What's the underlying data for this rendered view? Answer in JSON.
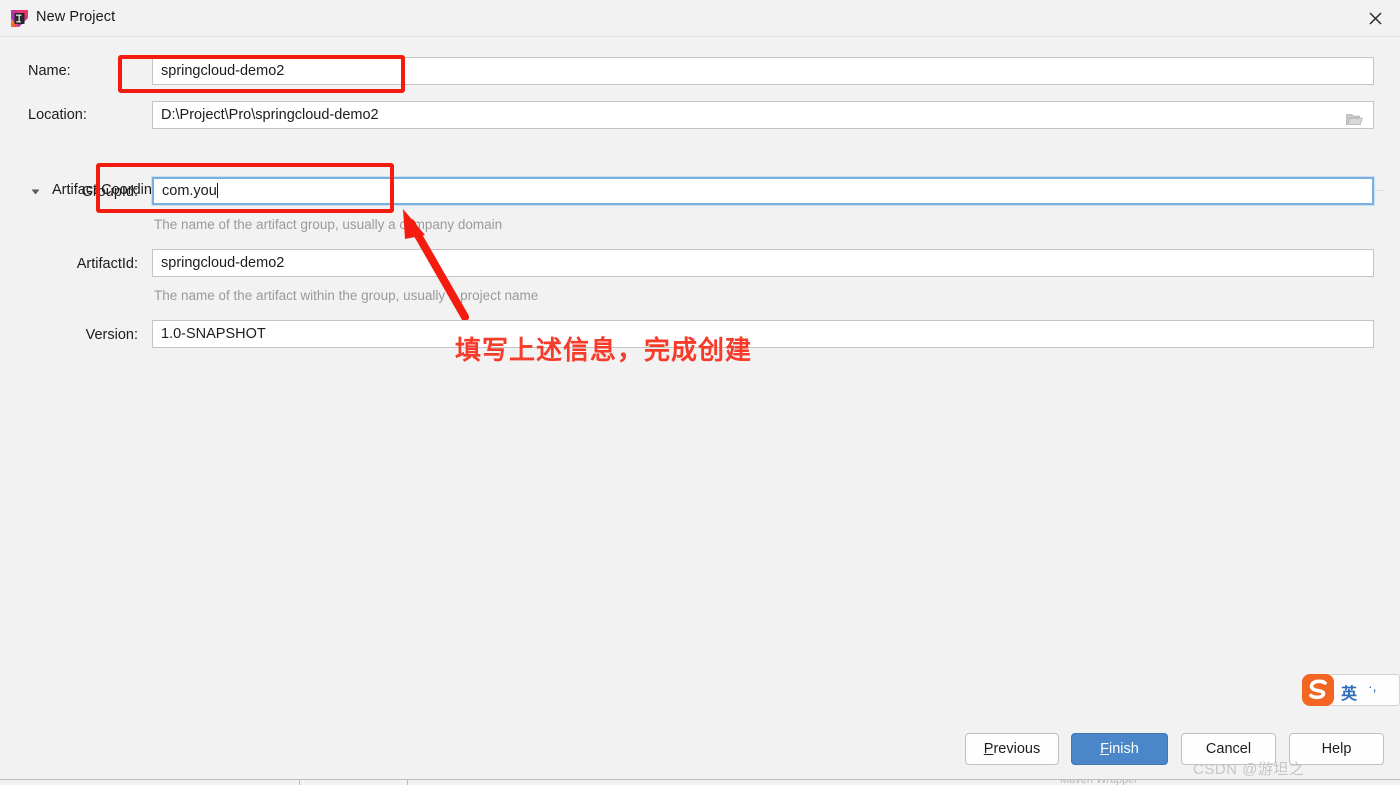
{
  "window": {
    "title": "New Project",
    "app_icon": "intellij-idea-icon",
    "close_icon": "close-icon"
  },
  "form": {
    "fields": [
      {
        "label": "Name:",
        "value": "springcloud-demo2"
      },
      {
        "label": "Location:",
        "value": "D:\\Project\\Pro\\springcloud-demo2",
        "browse_icon": "folder-icon"
      },
      {
        "label": "GroupId:",
        "value": "com.you",
        "focused": true,
        "hint": "The name of the artifact group, usually a company domain"
      },
      {
        "label": "ArtifactId:",
        "value": "springcloud-demo2",
        "hint": "The name of the artifact within the group, usually a project name"
      },
      {
        "label": "Version:",
        "value": "1.0-SNAPSHOT"
      }
    ],
    "section": {
      "title": "Artifact Coordinates",
      "expanded": true,
      "toggle_icon": "triangle-down-icon"
    }
  },
  "annotations": {
    "note": "填写上述信息，完成创建",
    "accent_color": "#f41b0f",
    "text_color": "#f73b2a",
    "boxes": [
      {
        "target": "name-field"
      },
      {
        "target": "groupid-field"
      }
    ],
    "arrow": {
      "from": "note-text",
      "to": "groupid-field"
    }
  },
  "ime": {
    "name": "sogou-input-method",
    "mode_label": "英",
    "dots_label": "·,"
  },
  "buttons": [
    {
      "label": "Previous",
      "mnemonic": "P",
      "primary": false
    },
    {
      "label": "Finish",
      "mnemonic": "F",
      "primary": true
    },
    {
      "label": "Cancel",
      "mnemonic": "",
      "primary": false
    },
    {
      "label": "Help",
      "mnemonic": "",
      "primary": false
    }
  ],
  "watermark": "CSDN @游坦之"
}
